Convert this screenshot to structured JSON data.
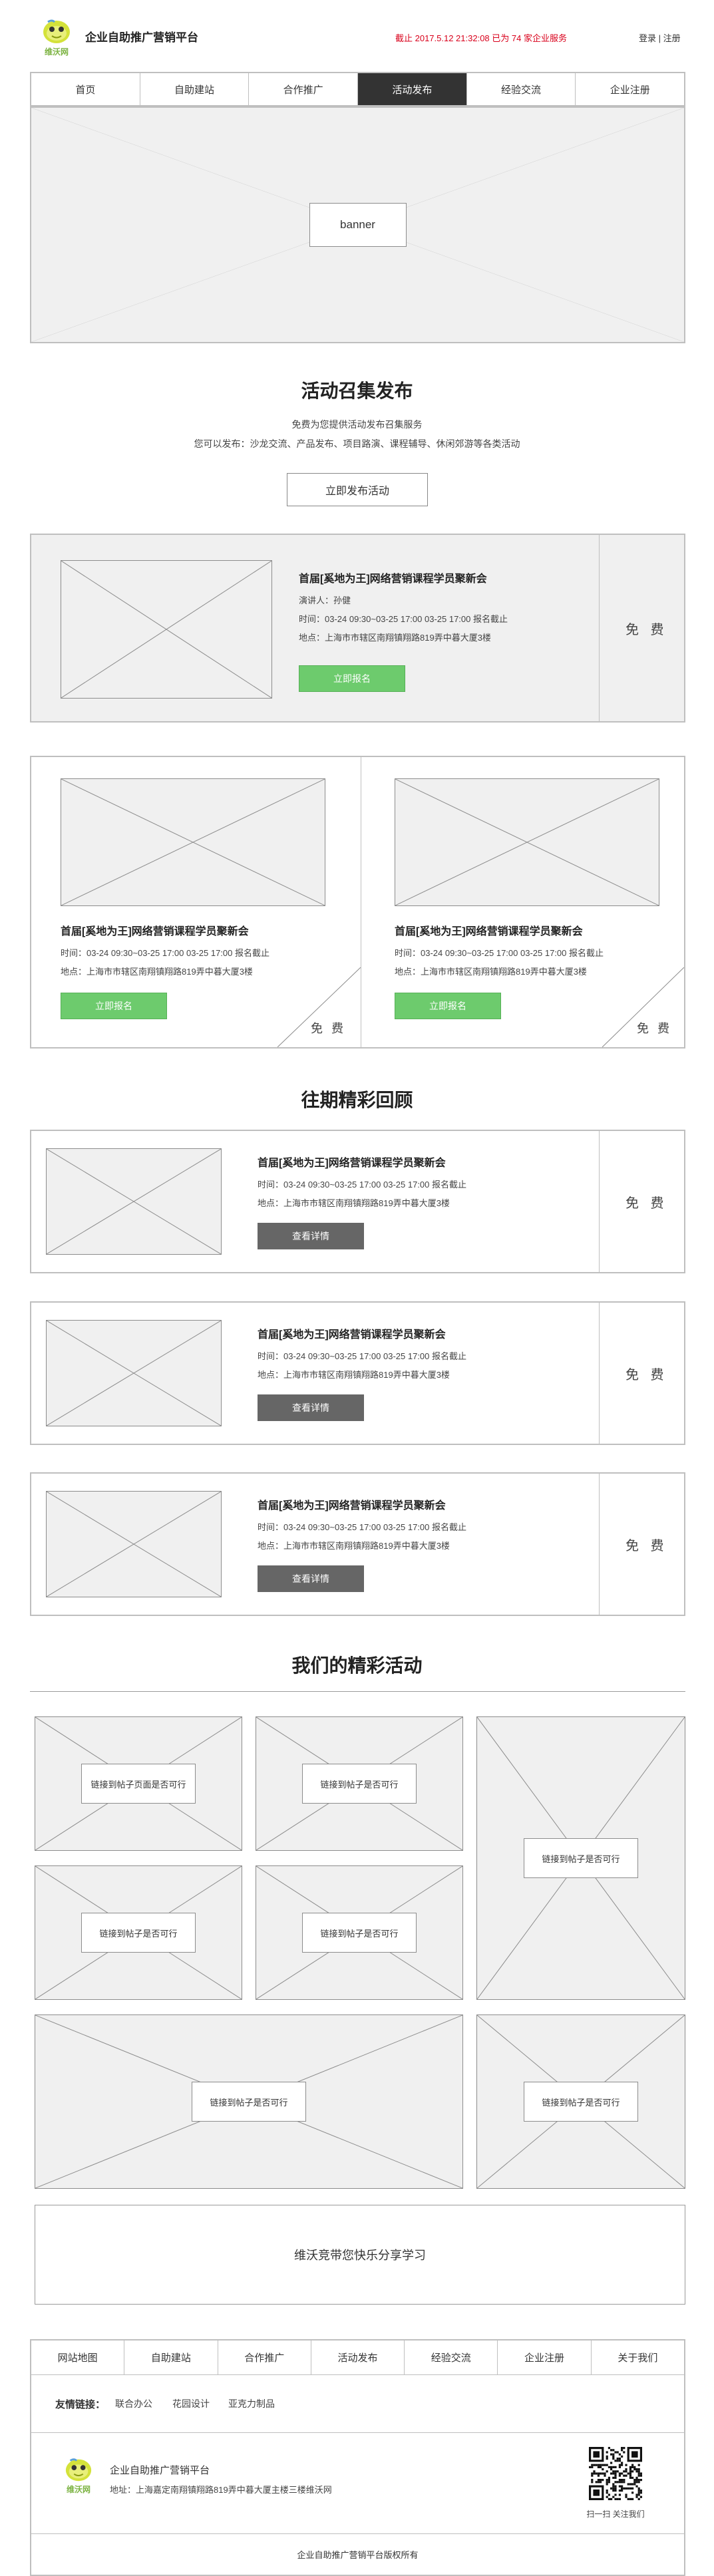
{
  "header": {
    "logo_text": "维沃网",
    "site_title": "企业自助推广营销平台",
    "notice": "截止 2017.5.12 21:32:08 已为 74 家企业服务",
    "login": "登录",
    "separator": "|",
    "register": "注册"
  },
  "nav": {
    "items": [
      "首页",
      "自助建站",
      "合作推广",
      "活动发布",
      "经验交流",
      "企业注册"
    ],
    "active_index": 3
  },
  "banner": {
    "label": "banner"
  },
  "publish": {
    "title": "活动召集发布",
    "line1": "免费为您提供活动发布召集服务",
    "line2": "您可以发布：沙龙交流、产品发布、项目路演、课程辅导、休闲郊游等各类活动",
    "button": "立即发布活动"
  },
  "featured": {
    "title": "首届[奚地为王]网络营销课程学员聚新会",
    "speaker": "演讲人：孙健",
    "time": "时间：03-24 09:30~03-25 17:00 03-25 17:00 报名截止",
    "place": "地点：上海市市辖区南翔镇翔路819弄中暮大厦3楼",
    "button": "立即报名",
    "price": "免 费"
  },
  "cards": [
    {
      "title": "首届[奚地为王]网络营销课程学员聚新会",
      "time": "时间：03-24 09:30~03-25 17:00 03-25 17:00 报名截止",
      "place": "地点：上海市市辖区南翔镇翔路819弄中暮大厦3楼",
      "button": "立即报名",
      "price": "免 费"
    },
    {
      "title": "首届[奚地为王]网络营销课程学员聚新会",
      "time": "时间：03-24 09:30~03-25 17:00 03-25 17:00 报名截止",
      "place": "地点：上海市市辖区南翔镇翔路819弄中暮大厦3楼",
      "button": "立即报名",
      "price": "免 费"
    }
  ],
  "review": {
    "title": "往期精彩回顾",
    "items": [
      {
        "title": "首届[奚地为王]网络营销课程学员聚新会",
        "time": "时间：03-24 09:30~03-25 17:00 03-25 17:00 报名截止",
        "place": "地点：上海市市辖区南翔镇翔路819弄中暮大厦3楼",
        "button": "查看详情",
        "price": "免 费"
      },
      {
        "title": "首届[奚地为王]网络营销课程学员聚新会",
        "time": "时间：03-24 09:30~03-25 17:00 03-25 17:00 报名截止",
        "place": "地点：上海市市辖区南翔镇翔路819弄中暮大厦3楼",
        "button": "查看详情",
        "price": "免 费"
      },
      {
        "title": "首届[奚地为王]网络营销课程学员聚新会",
        "time": "时间：03-24 09:30~03-25 17:00 03-25 17:00 报名截止",
        "place": "地点：上海市市辖区南翔镇翔路819弄中暮大厦3楼",
        "button": "查看详情",
        "price": "免 费"
      }
    ]
  },
  "gallery": {
    "title": "我们的精彩活动",
    "tiles": [
      "链接到帖子页面是否可行",
      "链接到帖子是否可行",
      "链接到帖子是否可行",
      "链接到帖子是否可行",
      "链接到帖子是否可行",
      "链接到帖子是否可行",
      "链接到帖子是否可行"
    ],
    "share_text": "维沃竞带您快乐分享学习"
  },
  "footer": {
    "nav": [
      "网站地图",
      "自助建站",
      "合作推广",
      "活动发布",
      "经验交流",
      "企业注册",
      "关于我们"
    ],
    "links_label": "友情链接：",
    "links": [
      "联合办公",
      "花园设计",
      "亚克力制品"
    ],
    "logo_text": "维沃网",
    "company": "企业自助推广营销平台",
    "address": "地址：上海嘉定南翔镇翔路819弄中暮大厦主楼三楼维沃网",
    "qr_caption": "扫一扫 关注我们",
    "copyright": "企业自助推广营销平台版权所有"
  },
  "colors": {
    "accent_green": "#6dcb6d",
    "active_nav": "#333333",
    "notice_red": "#d9001b",
    "logo_yellow": "#d4e23a"
  }
}
